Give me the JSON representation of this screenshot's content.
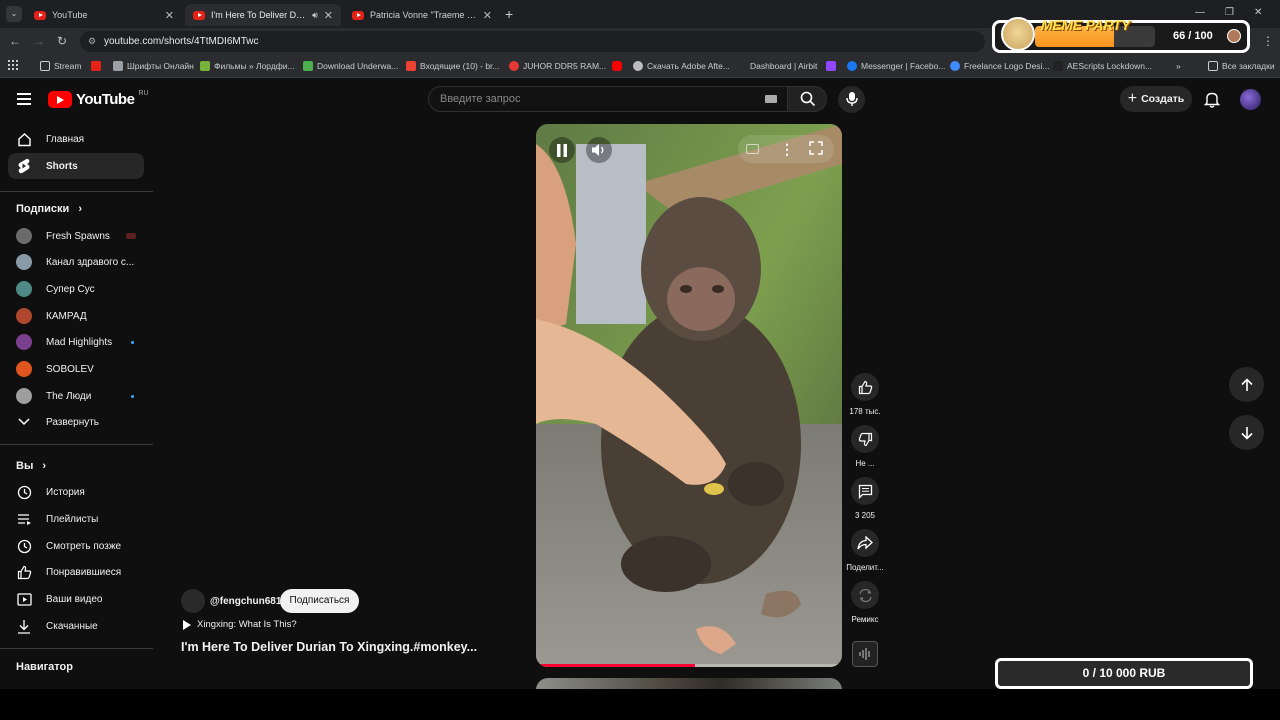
{
  "browser": {
    "tabs": [
      {
        "title": "YouTube",
        "active": false
      },
      {
        "title": "I'm Here To Deliver Durian To",
        "active": true
      },
      {
        "title": "Patricia Vonne \"Traeme Paz\" - Y",
        "active": false
      }
    ],
    "url": "youtube.com/shorts/4TtMDI6MTwc",
    "bookmarks": [
      {
        "label": "Stream",
        "color": "#c8c8c8"
      },
      {
        "label": "",
        "color": "#e62117"
      },
      {
        "label": "Шрифты Онлайн",
        "color": "#9aa0a6"
      },
      {
        "label": "Фильмы » Лордфи...",
        "color": "#77b33a"
      },
      {
        "label": "Download Underwa...",
        "color": "#4caf50"
      },
      {
        "label": "Входящие (10) - br...",
        "color": "#ea4335"
      },
      {
        "label": "JUHOR DDR5 RAM...",
        "color": "#e53935"
      },
      {
        "label": "",
        "color": "#ff0000"
      },
      {
        "label": "Скачать Adobe Afte...",
        "color": "#bdbdbd"
      },
      {
        "label": "Dashboard | Airbit",
        "color": "#2b2c2f"
      },
      {
        "label": "",
        "color": "#9146ff"
      },
      {
        "label": "Messenger | Facebo...",
        "color": "#1877f2"
      },
      {
        "label": "Freelance Logo Desi...",
        "color": "#3d8bfd"
      },
      {
        "label": "AEScripts Lockdown...",
        "color": "#222222"
      }
    ],
    "all_bookmarks": "Все закладки"
  },
  "overlay": {
    "meme_title": "MEME PARTY",
    "meme_progress": "66 / 100",
    "meme_fraction": 0.66,
    "donation": "0 / 10 000 RUB"
  },
  "header": {
    "logo": "YouTube",
    "region": "RU",
    "search_placeholder": "Введите запрос",
    "create_label": "Создать"
  },
  "sidebar": {
    "main": [
      {
        "label": "Главная",
        "icon": "home-icon",
        "active": false
      },
      {
        "label": "Shorts",
        "icon": "shorts-icon",
        "active": true
      }
    ],
    "subs_header": "Подписки",
    "subs": [
      {
        "label": "Fresh Spawns",
        "color": "#6b6b6b",
        "badge": "live"
      },
      {
        "label": "Канал здравого с...",
        "color": "#8a9ba8",
        "badge": ""
      },
      {
        "label": "Супер Сус",
        "color": "#4f8a86",
        "badge": ""
      },
      {
        "label": "КАМРАД",
        "color": "#b2472f",
        "badge": ""
      },
      {
        "label": "Mad Highlights",
        "color": "#7a3f8f",
        "badge": "dot"
      },
      {
        "label": "SOBOLEV",
        "color": "#e0541d",
        "badge": ""
      },
      {
        "label": "The Люди",
        "color": "#9e9e9e",
        "badge": "dot"
      }
    ],
    "expand_label": "Развернуть",
    "you_header": "Вы",
    "you": [
      {
        "label": "История",
        "icon": "history-icon"
      },
      {
        "label": "Плейлисты",
        "icon": "playlists-icon"
      },
      {
        "label": "Смотреть позже",
        "icon": "watch-later-icon"
      },
      {
        "label": "Понравившиеся",
        "icon": "liked-icon"
      },
      {
        "label": "Ваши видео",
        "icon": "your-videos-icon"
      },
      {
        "label": "Скачанные",
        "icon": "downloads-icon"
      }
    ],
    "nav_header": "Навигатор"
  },
  "short": {
    "channel": "@fengchun681",
    "subscribe": "Подписаться",
    "sound": "Xingxing: What Is This?",
    "title": "I'm Here To Deliver Durian To Xingxing.#monkey...",
    "likes": "178 тыс.",
    "dislike": "Не ...",
    "comments": "3 205",
    "share": "Поделит...",
    "remix": "Ремикс"
  },
  "colors": {
    "accent": "#ff0000",
    "link": "#3ea6ff",
    "meme_bar": "#f7941d"
  }
}
